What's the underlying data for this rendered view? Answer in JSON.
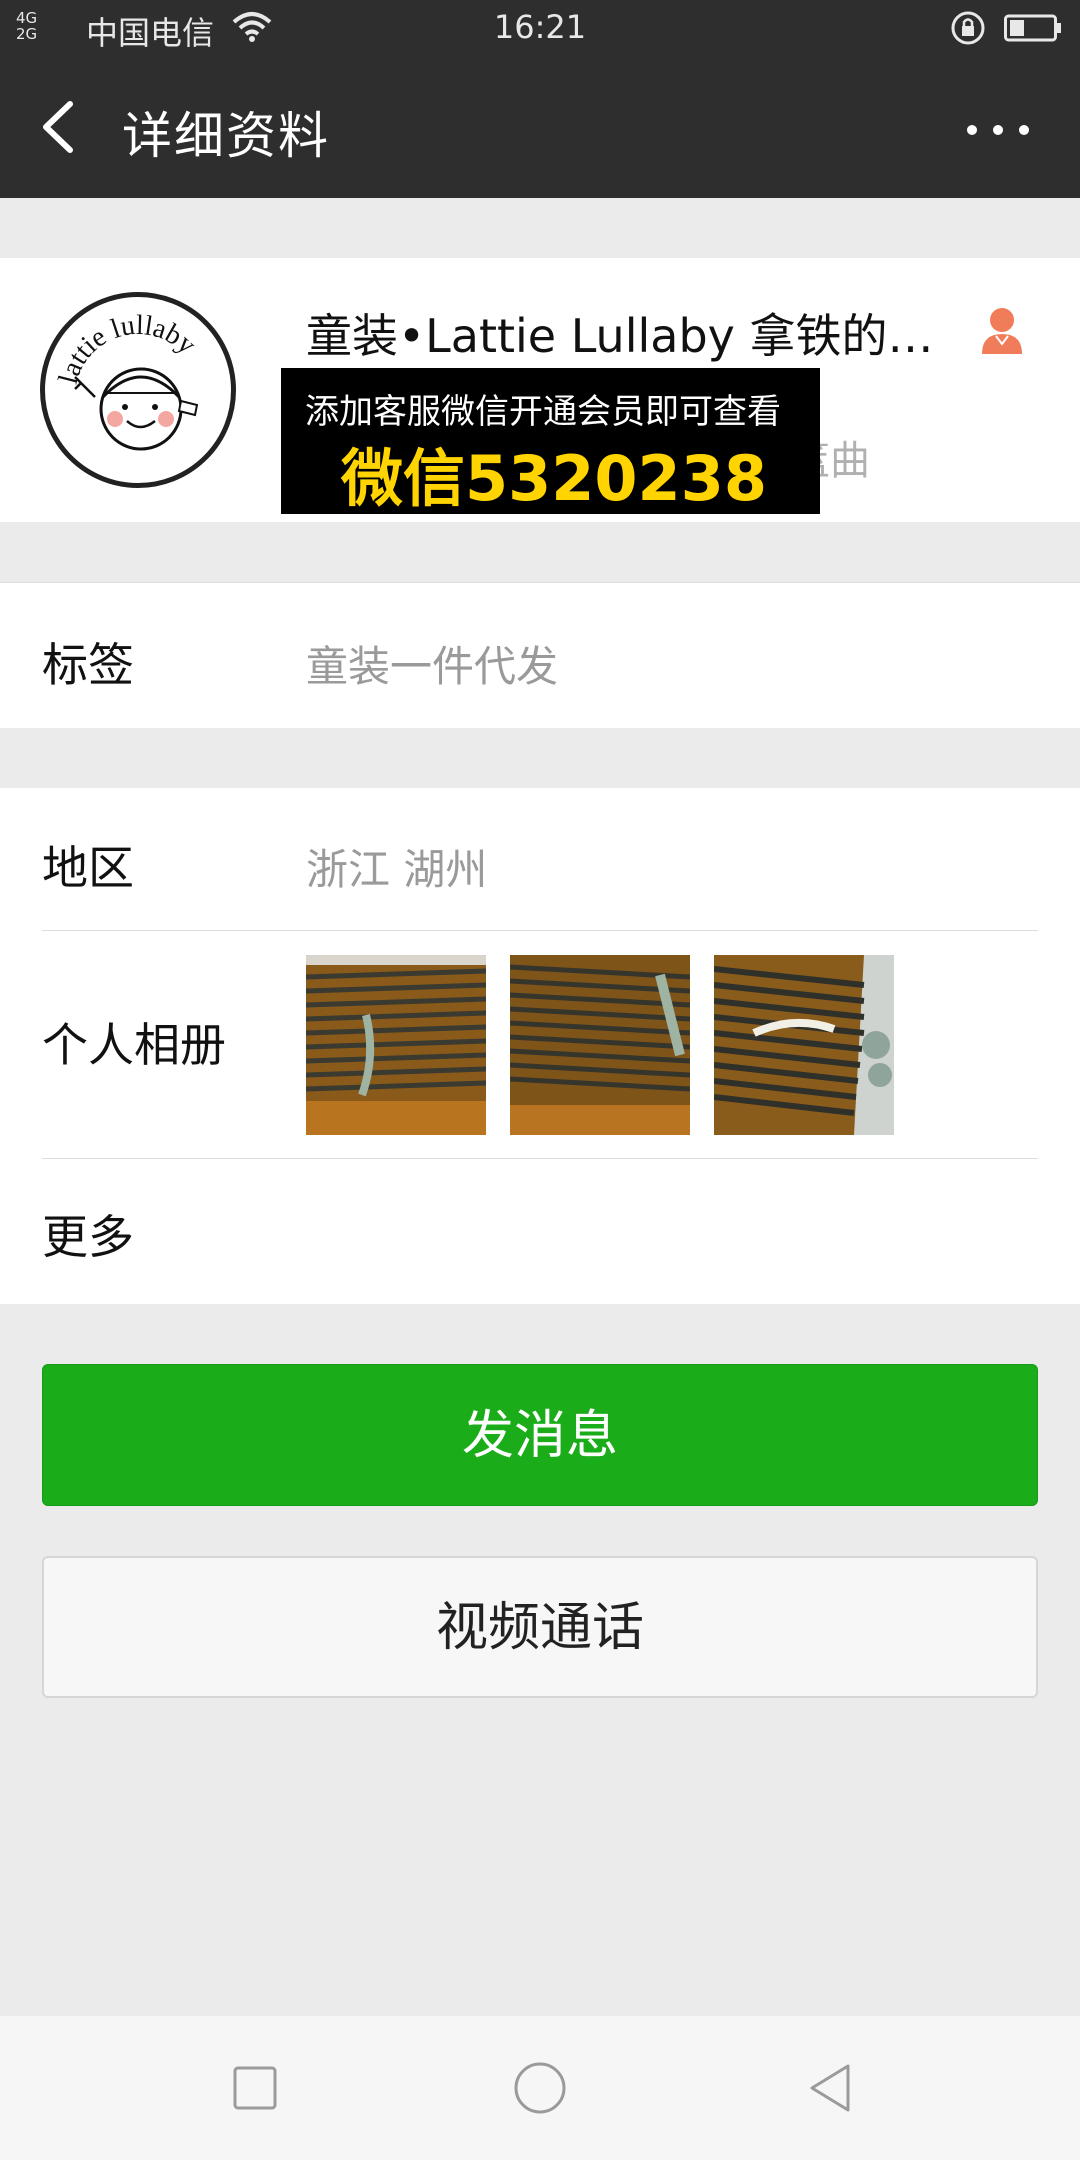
{
  "status_bar": {
    "network_top": "4G",
    "network_bottom": "2G",
    "carrier": "中国电信",
    "time": "16:21"
  },
  "navbar": {
    "title": "详细资料",
    "back_icon": "chevron-left-icon",
    "more_icon": "more-dots-icon"
  },
  "profile": {
    "avatar_text": "lattie lullaby",
    "name": "童装•Lattie Lullaby 拿铁的摇篮曲",
    "faded_text": "篮曲",
    "gender_icon": "person-icon",
    "gender_color": "#f07c5a"
  },
  "overlay_banner": {
    "line1": "添加客服微信开通会员即可查看",
    "line2": "微信5320238",
    "line2_color": "#ffd400"
  },
  "tags_row": {
    "label": "标签",
    "value": "童装一件代发"
  },
  "region_row": {
    "label": "地区",
    "value": "浙江  湖州"
  },
  "album_row": {
    "label": "个人相册"
  },
  "more_row": {
    "label": "更多"
  },
  "actions": {
    "send_message": "发消息",
    "video_call": "视频通话",
    "primary_color": "#1aad19"
  },
  "system_nav": {
    "recents_icon": "square-icon",
    "home_icon": "circle-icon",
    "back_icon": "triangle-back-icon"
  }
}
